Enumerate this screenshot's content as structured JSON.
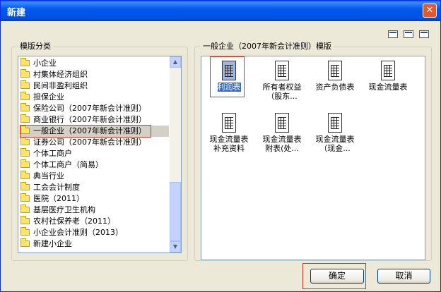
{
  "window": {
    "title": "新建"
  },
  "left_group": {
    "legend": "模版分类",
    "items": [
      "小企业",
      "村集体经济组织",
      "民间非盈利组织",
      "担保企业",
      "保险公司（2007年新会计准则）",
      "商业银行（2007年新会计准则）",
      "一般企业（2007年新会计准则）",
      "证券公司（2007年新会计准则）",
      "个体工商户",
      "个体工商户（简易）",
      "典当行业",
      "工会会计制度",
      "医院（2011）",
      "基层医疗卫生机构",
      "农村社保养老（2011）",
      "小企业会计准则（2013）",
      "新建小企业"
    ],
    "selected_index": 6
  },
  "right_group": {
    "legend": "一般企业（2007年新会计准则）模版",
    "templates": [
      {
        "line1": "利润表",
        "line2": ""
      },
      {
        "line1": "所有者权益",
        "line2": "（股东..."
      },
      {
        "line1": "资产负债表",
        "line2": ""
      },
      {
        "line1": "现金流量表",
        "line2": ""
      },
      {
        "line1": "现金流量表",
        "line2": "补充资料"
      },
      {
        "line1": "现金流量表",
        "line2": "附表(处..."
      },
      {
        "line1": "现金流量表",
        "line2": "（现金..."
      }
    ],
    "selected_index": 0
  },
  "buttons": {
    "ok": "确定",
    "cancel": "取消"
  },
  "icons": {
    "close": "close-icon",
    "folder": "folder-icon",
    "document": "table-document-icon",
    "view_modes": [
      "large-icons-view-icon",
      "small-icons-view-icon",
      "details-view-icon"
    ]
  },
  "colors": {
    "titlebar": "#0058ee",
    "selection": "#316ac5",
    "highlight_box": "#e0301e"
  }
}
